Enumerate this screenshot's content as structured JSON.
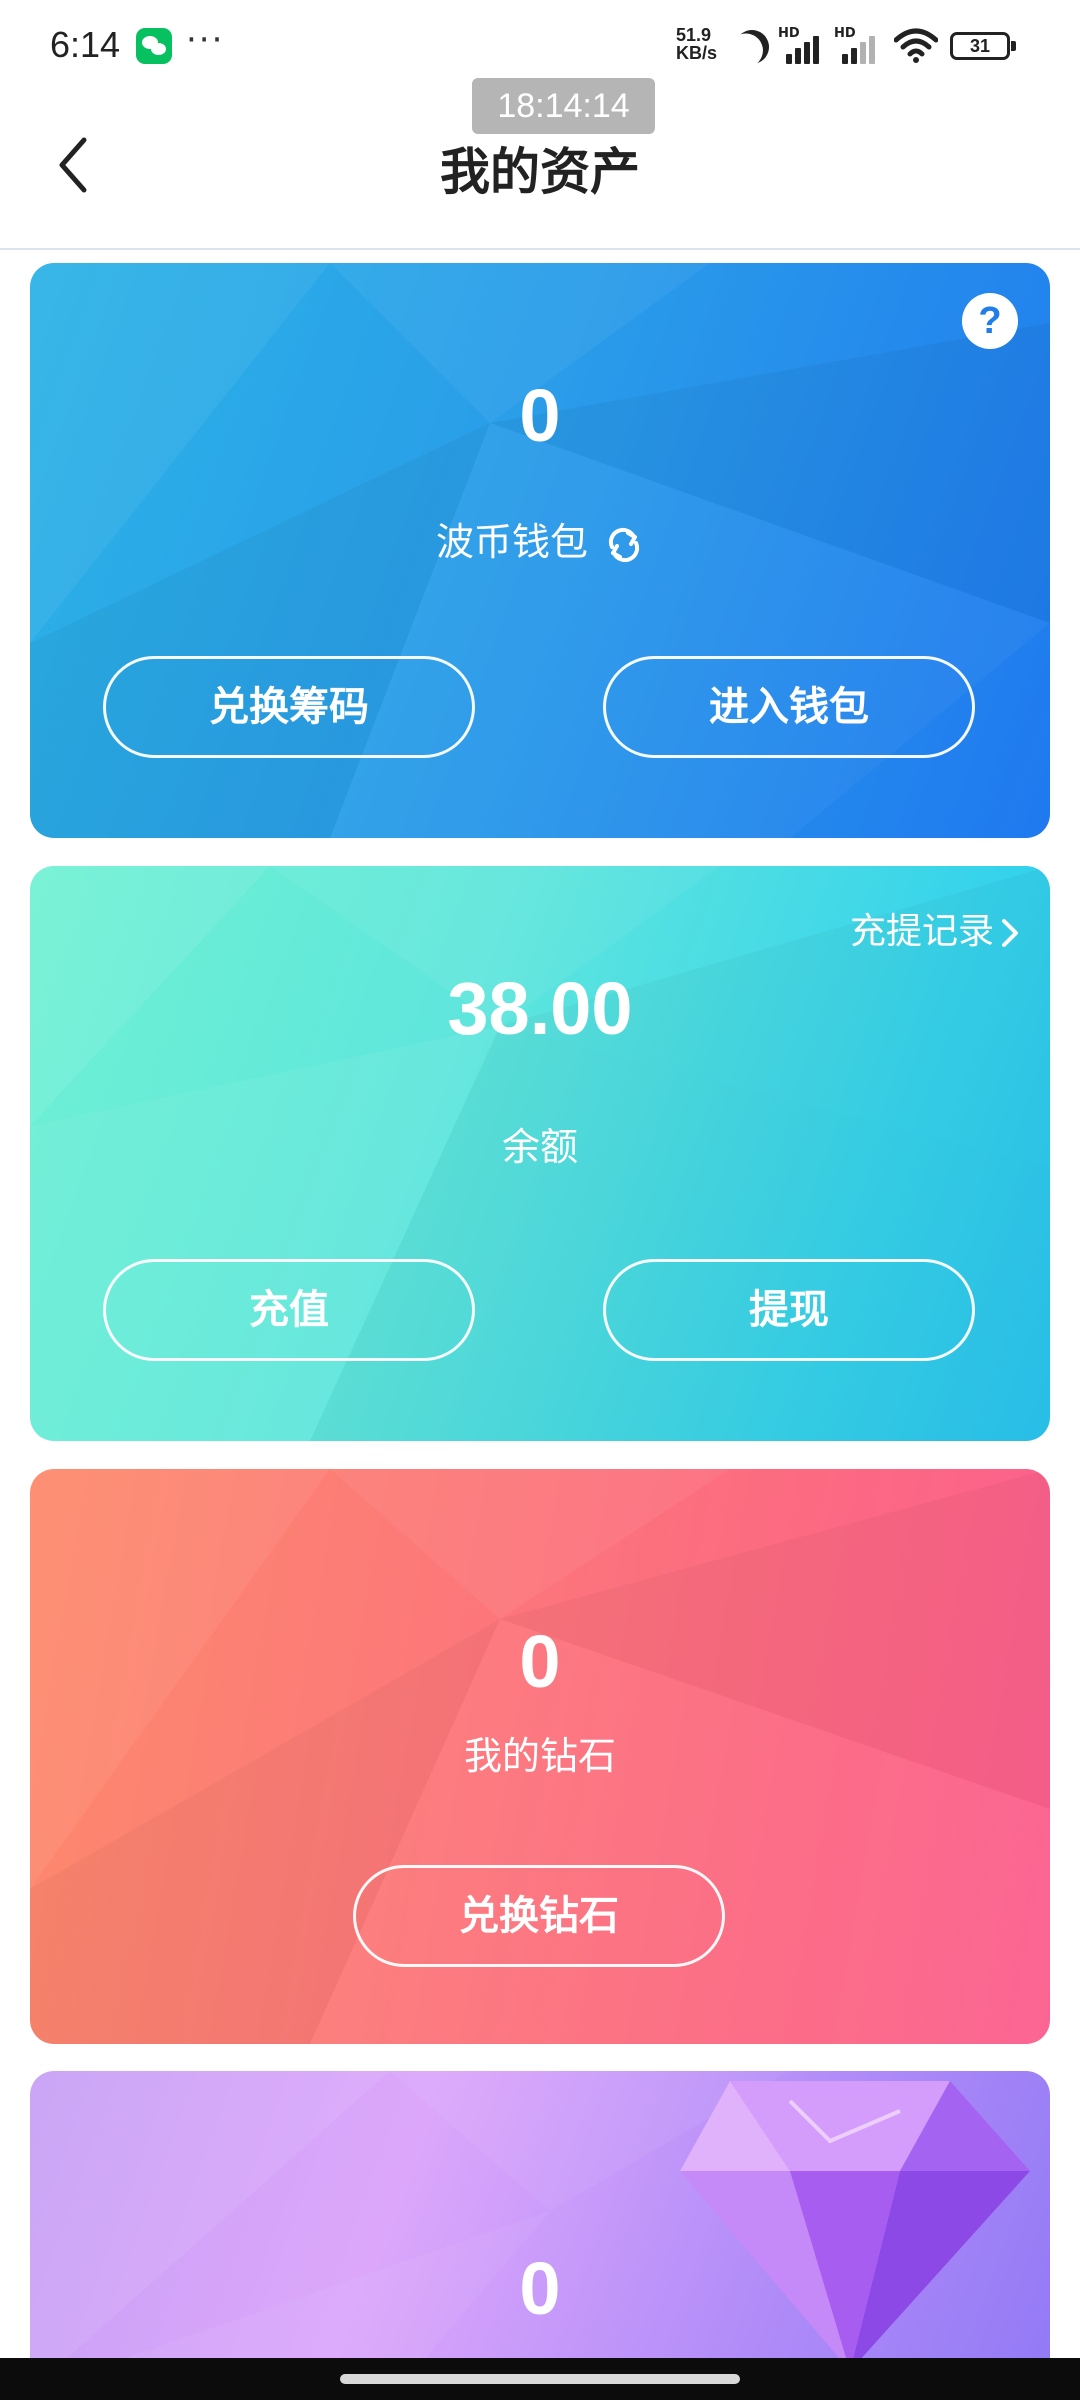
{
  "status_bar": {
    "time": "6:14",
    "more": "···",
    "net_speed_value": "51.9",
    "net_speed_unit": "KB/s",
    "sim1": "HD",
    "sim2": "HD",
    "battery": "31"
  },
  "overlay_time": "18:14:14",
  "header": {
    "title": "我的资产"
  },
  "wallet_card": {
    "amount": "0",
    "label": "波币钱包",
    "help": "?",
    "btn_exchange": "兑换筹码",
    "btn_enter": "进入钱包"
  },
  "balance_card": {
    "record_link": "充提记录",
    "amount": "38.00",
    "label": "余额",
    "btn_recharge": "充值",
    "btn_withdraw": "提现"
  },
  "diamond_card": {
    "amount": "0",
    "label": "我的钻石",
    "btn_exchange": "兑换钻石"
  },
  "fourth_card": {
    "amount": "0"
  },
  "colors": {
    "wallet_blue": "#1f79ef",
    "balance_cyan": "#35d2ec",
    "diamond_pink": "#fb5f8f",
    "purple": "#b18cf8"
  }
}
